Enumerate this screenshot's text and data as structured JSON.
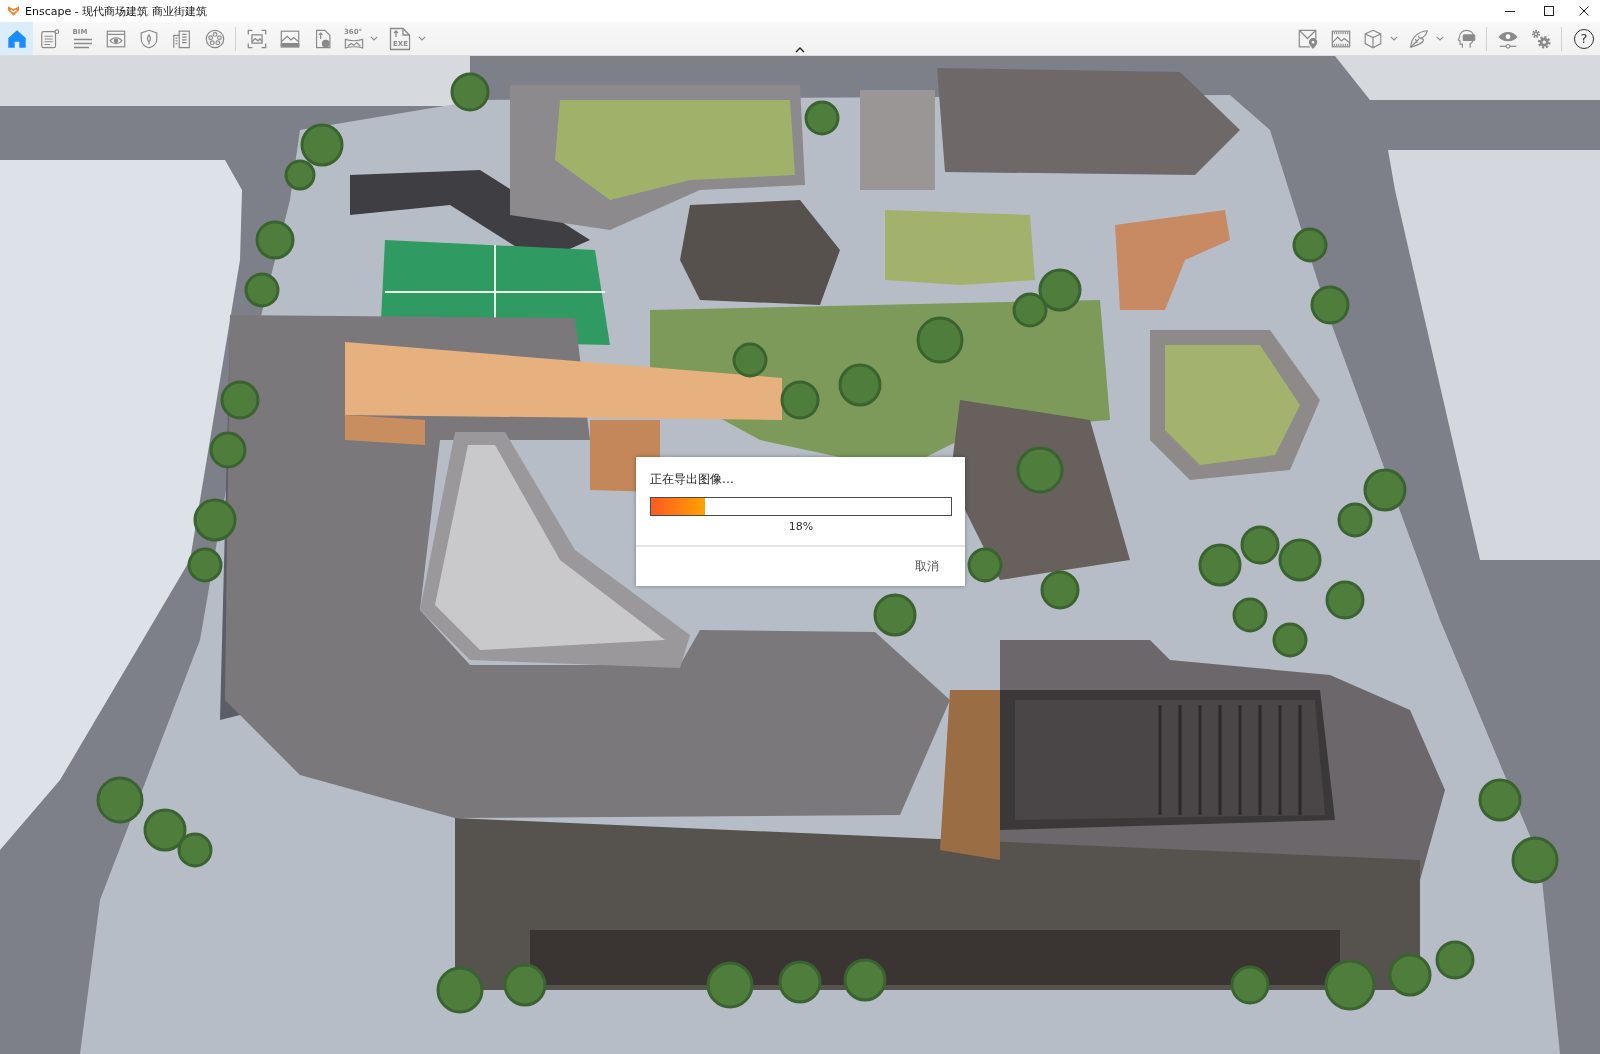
{
  "window": {
    "title": "Enscape - 现代商场建筑 商业街建筑"
  },
  "toolbar": {
    "left_groups": [
      [
        {
          "selected": true,
          "menu": false
        },
        {
          "selected": false,
          "menu": false
        },
        {
          "selected": false,
          "menu": false,
          "label": "BIM"
        },
        {
          "selected": false,
          "menu": false
        },
        {
          "selected": false,
          "menu": false
        },
        {
          "selected": false,
          "menu": false
        },
        {
          "selected": false,
          "menu": false
        }
      ],
      [
        {
          "selected": false,
          "menu": false
        },
        {
          "selected": false,
          "menu": false
        },
        {
          "selected": false,
          "menu": false
        },
        {
          "selected": false,
          "menu": true,
          "label": "360°"
        },
        {
          "selected": false,
          "menu": true,
          "label": "EXE"
        }
      ]
    ],
    "right_groups": [
      [
        {
          "selected": false,
          "menu": false
        },
        {
          "selected": false,
          "menu": false
        },
        {
          "selected": false,
          "menu": true
        },
        {
          "selected": false,
          "menu": true
        },
        {
          "selected": false,
          "menu": false
        }
      ],
      [
        {
          "selected": false,
          "menu": false
        },
        {
          "selected": false,
          "menu": false
        }
      ],
      [
        {
          "selected": false,
          "menu": false,
          "label": "?"
        }
      ]
    ]
  },
  "dialog": {
    "title": "正在导出图像…",
    "progress": {
      "level": 0.18,
      "reading": "18%"
    },
    "buttons": [
      "取消"
    ]
  }
}
